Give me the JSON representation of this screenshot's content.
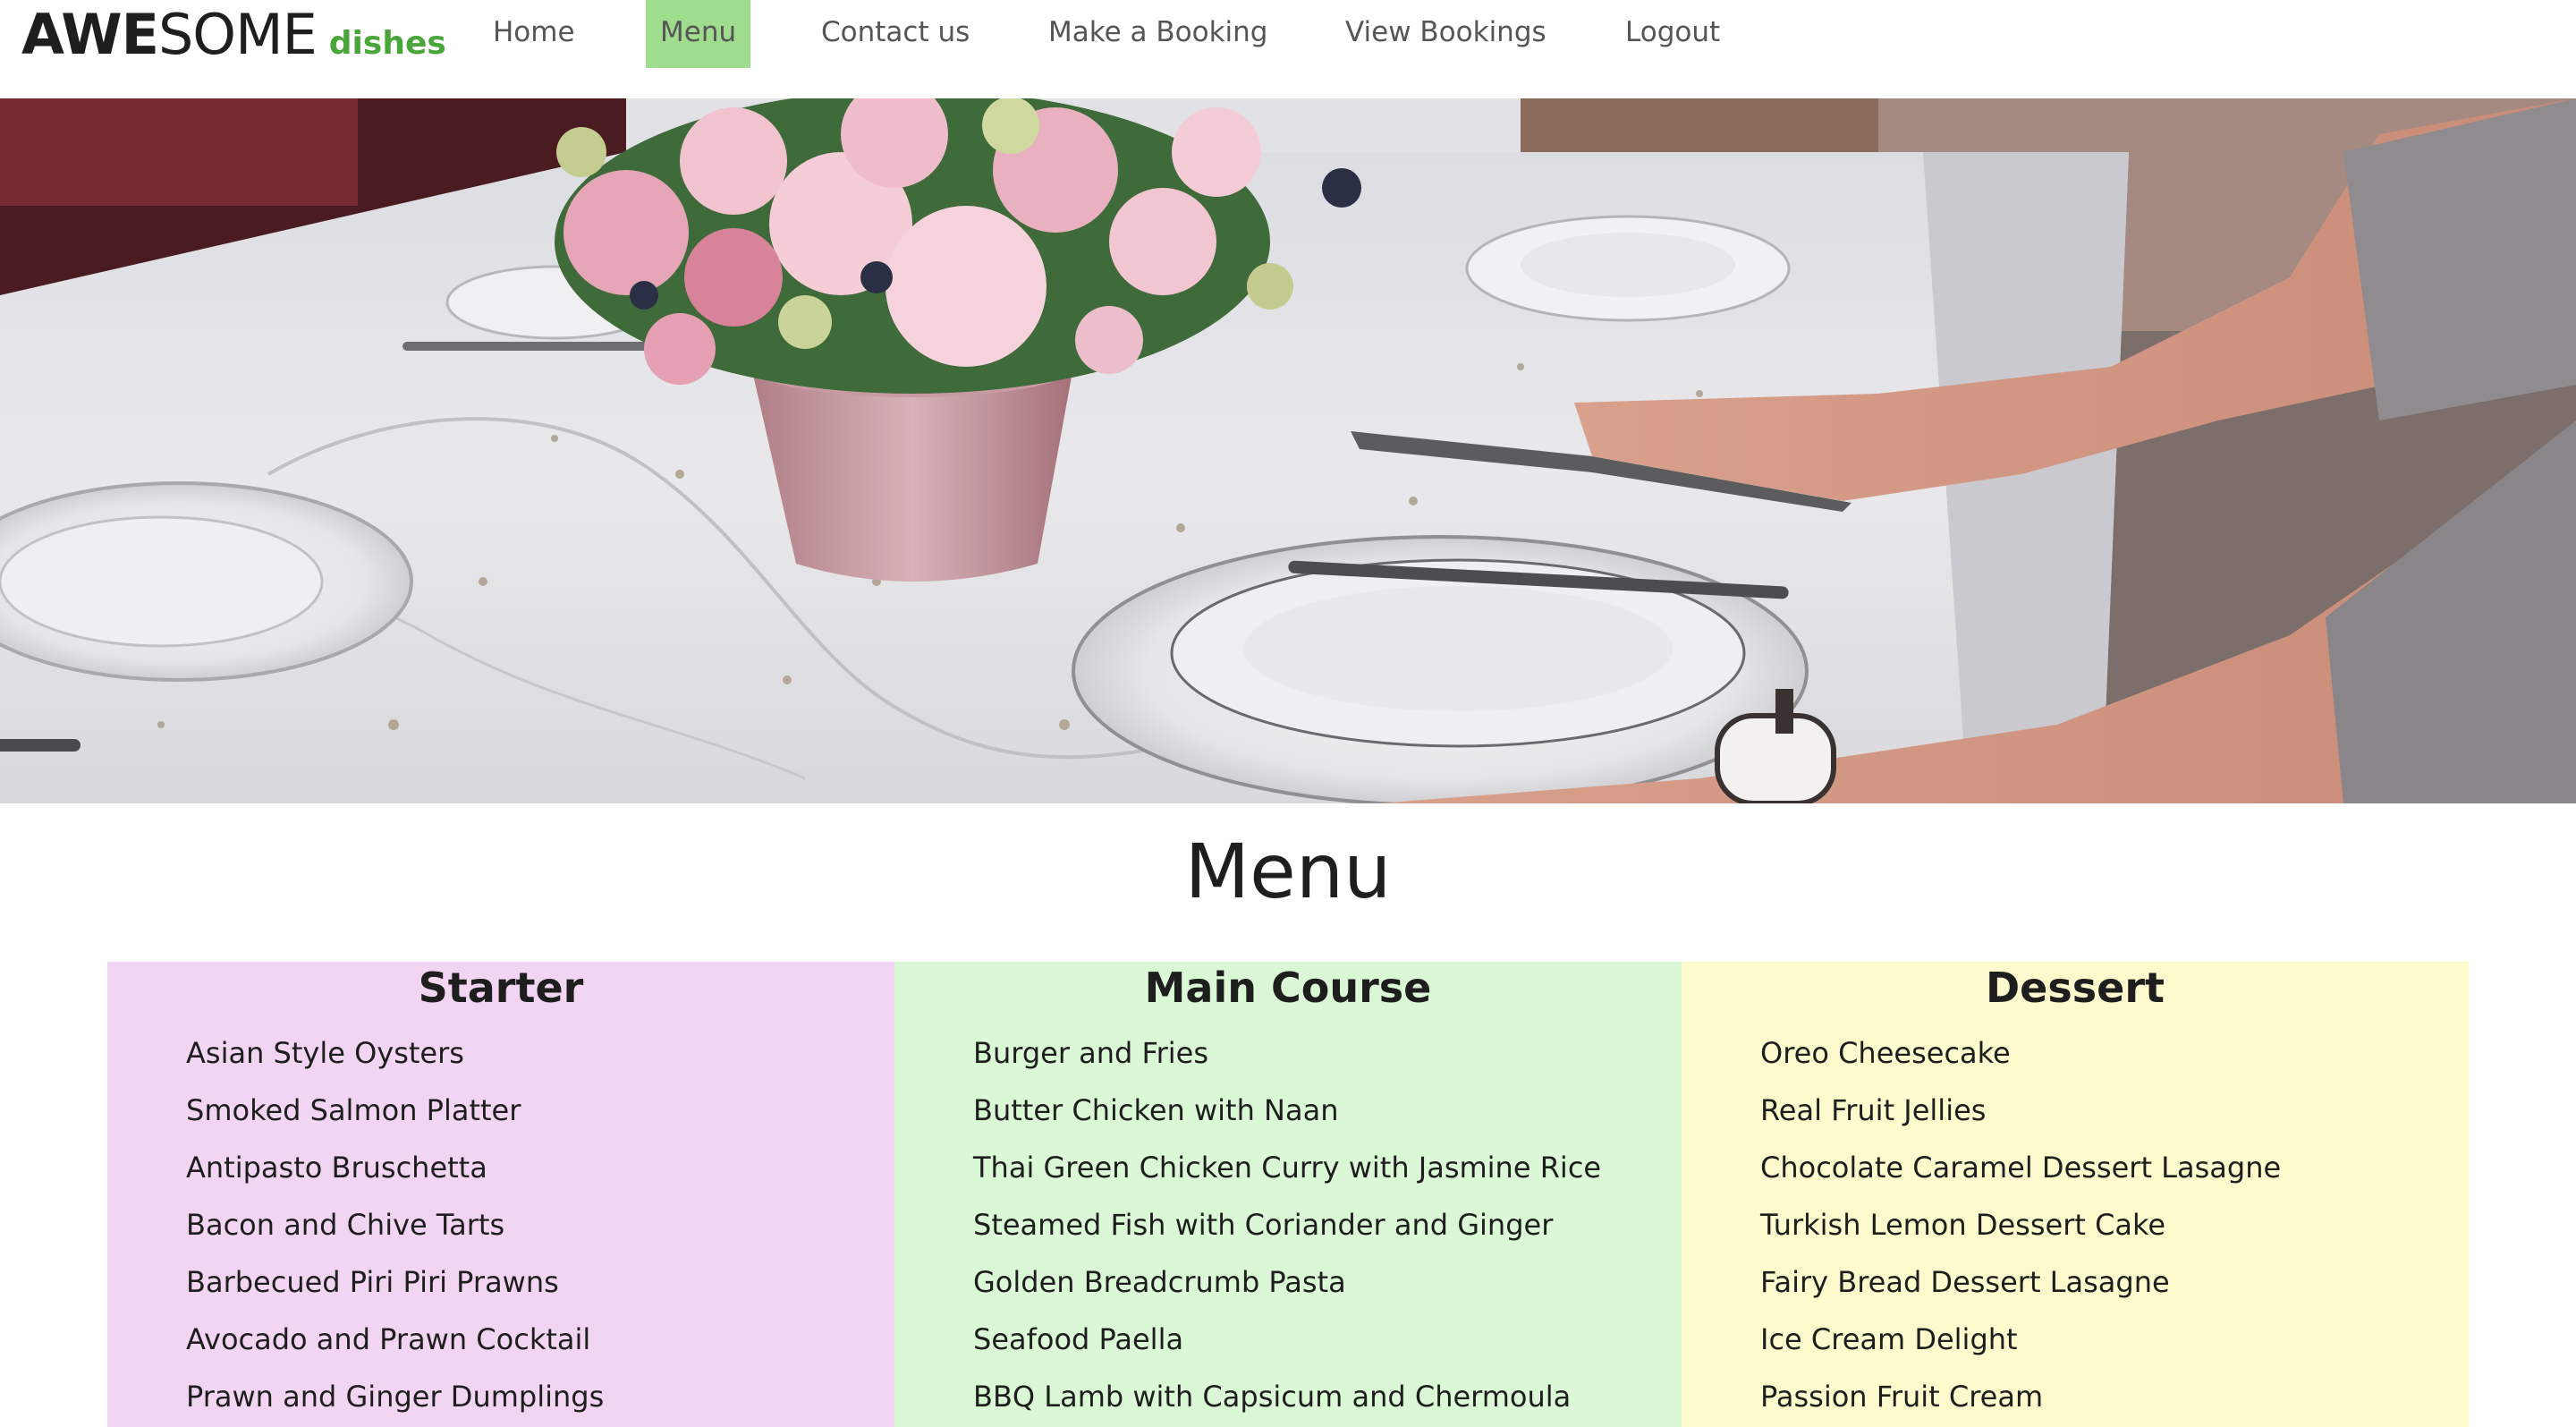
{
  "logo": {
    "part_bold": "AWE",
    "part_light": "SOME",
    "part_green": "dishes"
  },
  "nav": {
    "items": [
      {
        "label": "Home",
        "active": false
      },
      {
        "label": "Menu",
        "active": true
      },
      {
        "label": "Contact us",
        "active": false
      },
      {
        "label": "Make a Booking",
        "active": false
      },
      {
        "label": "View Bookings",
        "active": false
      },
      {
        "label": "Logout",
        "active": false
      }
    ]
  },
  "hero": {
    "image": "table-setting-flowers-photo"
  },
  "menu": {
    "title": "Menu",
    "columns": [
      {
        "heading": "Starter",
        "items": [
          "Asian Style Oysters",
          "Smoked Salmon Platter",
          "Antipasto Bruschetta",
          "Bacon and Chive Tarts",
          "Barbecued Piri Piri Prawns",
          "Avocado and Prawn Cocktail",
          "Prawn and Ginger Dumplings"
        ]
      },
      {
        "heading": "Main Course",
        "items": [
          "Burger and Fries",
          "Butter Chicken with Naan",
          "Thai Green Chicken Curry with Jasmine Rice",
          "Steamed Fish with Coriander and Ginger",
          "Golden Breadcrumb Pasta",
          "Seafood Paella",
          "BBQ Lamb with Capsicum and Chermoula"
        ]
      },
      {
        "heading": "Dessert",
        "items": [
          "Oreo Cheesecake",
          "Real Fruit Jellies",
          "Chocolate Caramel Dessert Lasagne",
          "Turkish Lemon Dessert Cake",
          "Fairy Bread Dessert Lasagne",
          "Ice Cream Delight",
          "Passion Fruit Cream"
        ]
      }
    ]
  },
  "colors": {
    "brand_green": "#4aa53a",
    "nav_active": "#9fdc8e",
    "starter_bg": "#f2d5f2",
    "main_bg": "#dbf8d6",
    "dessert_bg": "#fdfbcd"
  }
}
